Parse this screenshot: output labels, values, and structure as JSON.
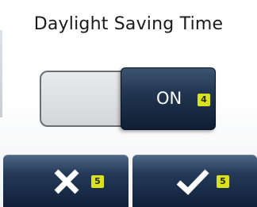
{
  "screen": {
    "title": "Daylight Saving Time"
  },
  "toggle": {
    "state_label": "ON",
    "badge": "4",
    "state": "on"
  },
  "footer": {
    "cancel": {
      "icon": "close-icon",
      "badge": "5"
    },
    "confirm": {
      "icon": "checkmark-icon",
      "badge": "5"
    }
  },
  "colors": {
    "badge": "#d9e21c",
    "button_dark": "#10203a",
    "button_light": "#4d6786"
  }
}
